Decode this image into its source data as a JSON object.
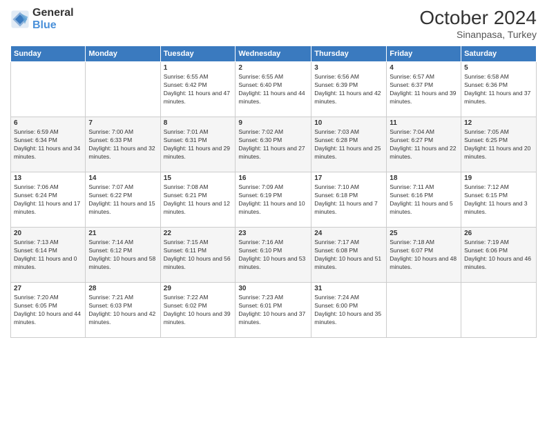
{
  "logo": {
    "line1": "General",
    "line2": "Blue"
  },
  "header": {
    "month": "October 2024",
    "location": "Sinanpasa, Turkey"
  },
  "weekdays": [
    "Sunday",
    "Monday",
    "Tuesday",
    "Wednesday",
    "Thursday",
    "Friday",
    "Saturday"
  ],
  "weeks": [
    [
      {
        "day": "",
        "sunrise": "",
        "sunset": "",
        "daylight": ""
      },
      {
        "day": "",
        "sunrise": "",
        "sunset": "",
        "daylight": ""
      },
      {
        "day": "1",
        "sunrise": "Sunrise: 6:55 AM",
        "sunset": "Sunset: 6:42 PM",
        "daylight": "Daylight: 11 hours and 47 minutes."
      },
      {
        "day": "2",
        "sunrise": "Sunrise: 6:55 AM",
        "sunset": "Sunset: 6:40 PM",
        "daylight": "Daylight: 11 hours and 44 minutes."
      },
      {
        "day": "3",
        "sunrise": "Sunrise: 6:56 AM",
        "sunset": "Sunset: 6:39 PM",
        "daylight": "Daylight: 11 hours and 42 minutes."
      },
      {
        "day": "4",
        "sunrise": "Sunrise: 6:57 AM",
        "sunset": "Sunset: 6:37 PM",
        "daylight": "Daylight: 11 hours and 39 minutes."
      },
      {
        "day": "5",
        "sunrise": "Sunrise: 6:58 AM",
        "sunset": "Sunset: 6:36 PM",
        "daylight": "Daylight: 11 hours and 37 minutes."
      }
    ],
    [
      {
        "day": "6",
        "sunrise": "Sunrise: 6:59 AM",
        "sunset": "Sunset: 6:34 PM",
        "daylight": "Daylight: 11 hours and 34 minutes."
      },
      {
        "day": "7",
        "sunrise": "Sunrise: 7:00 AM",
        "sunset": "Sunset: 6:33 PM",
        "daylight": "Daylight: 11 hours and 32 minutes."
      },
      {
        "day": "8",
        "sunrise": "Sunrise: 7:01 AM",
        "sunset": "Sunset: 6:31 PM",
        "daylight": "Daylight: 11 hours and 29 minutes."
      },
      {
        "day": "9",
        "sunrise": "Sunrise: 7:02 AM",
        "sunset": "Sunset: 6:30 PM",
        "daylight": "Daylight: 11 hours and 27 minutes."
      },
      {
        "day": "10",
        "sunrise": "Sunrise: 7:03 AM",
        "sunset": "Sunset: 6:28 PM",
        "daylight": "Daylight: 11 hours and 25 minutes."
      },
      {
        "day": "11",
        "sunrise": "Sunrise: 7:04 AM",
        "sunset": "Sunset: 6:27 PM",
        "daylight": "Daylight: 11 hours and 22 minutes."
      },
      {
        "day": "12",
        "sunrise": "Sunrise: 7:05 AM",
        "sunset": "Sunset: 6:25 PM",
        "daylight": "Daylight: 11 hours and 20 minutes."
      }
    ],
    [
      {
        "day": "13",
        "sunrise": "Sunrise: 7:06 AM",
        "sunset": "Sunset: 6:24 PM",
        "daylight": "Daylight: 11 hours and 17 minutes."
      },
      {
        "day": "14",
        "sunrise": "Sunrise: 7:07 AM",
        "sunset": "Sunset: 6:22 PM",
        "daylight": "Daylight: 11 hours and 15 minutes."
      },
      {
        "day": "15",
        "sunrise": "Sunrise: 7:08 AM",
        "sunset": "Sunset: 6:21 PM",
        "daylight": "Daylight: 11 hours and 12 minutes."
      },
      {
        "day": "16",
        "sunrise": "Sunrise: 7:09 AM",
        "sunset": "Sunset: 6:19 PM",
        "daylight": "Daylight: 11 hours and 10 minutes."
      },
      {
        "day": "17",
        "sunrise": "Sunrise: 7:10 AM",
        "sunset": "Sunset: 6:18 PM",
        "daylight": "Daylight: 11 hours and 7 minutes."
      },
      {
        "day": "18",
        "sunrise": "Sunrise: 7:11 AM",
        "sunset": "Sunset: 6:16 PM",
        "daylight": "Daylight: 11 hours and 5 minutes."
      },
      {
        "day": "19",
        "sunrise": "Sunrise: 7:12 AM",
        "sunset": "Sunset: 6:15 PM",
        "daylight": "Daylight: 11 hours and 3 minutes."
      }
    ],
    [
      {
        "day": "20",
        "sunrise": "Sunrise: 7:13 AM",
        "sunset": "Sunset: 6:14 PM",
        "daylight": "Daylight: 11 hours and 0 minutes."
      },
      {
        "day": "21",
        "sunrise": "Sunrise: 7:14 AM",
        "sunset": "Sunset: 6:12 PM",
        "daylight": "Daylight: 10 hours and 58 minutes."
      },
      {
        "day": "22",
        "sunrise": "Sunrise: 7:15 AM",
        "sunset": "Sunset: 6:11 PM",
        "daylight": "Daylight: 10 hours and 56 minutes."
      },
      {
        "day": "23",
        "sunrise": "Sunrise: 7:16 AM",
        "sunset": "Sunset: 6:10 PM",
        "daylight": "Daylight: 10 hours and 53 minutes."
      },
      {
        "day": "24",
        "sunrise": "Sunrise: 7:17 AM",
        "sunset": "Sunset: 6:08 PM",
        "daylight": "Daylight: 10 hours and 51 minutes."
      },
      {
        "day": "25",
        "sunrise": "Sunrise: 7:18 AM",
        "sunset": "Sunset: 6:07 PM",
        "daylight": "Daylight: 10 hours and 48 minutes."
      },
      {
        "day": "26",
        "sunrise": "Sunrise: 7:19 AM",
        "sunset": "Sunset: 6:06 PM",
        "daylight": "Daylight: 10 hours and 46 minutes."
      }
    ],
    [
      {
        "day": "27",
        "sunrise": "Sunrise: 7:20 AM",
        "sunset": "Sunset: 6:05 PM",
        "daylight": "Daylight: 10 hours and 44 minutes."
      },
      {
        "day": "28",
        "sunrise": "Sunrise: 7:21 AM",
        "sunset": "Sunset: 6:03 PM",
        "daylight": "Daylight: 10 hours and 42 minutes."
      },
      {
        "day": "29",
        "sunrise": "Sunrise: 7:22 AM",
        "sunset": "Sunset: 6:02 PM",
        "daylight": "Daylight: 10 hours and 39 minutes."
      },
      {
        "day": "30",
        "sunrise": "Sunrise: 7:23 AM",
        "sunset": "Sunset: 6:01 PM",
        "daylight": "Daylight: 10 hours and 37 minutes."
      },
      {
        "day": "31",
        "sunrise": "Sunrise: 7:24 AM",
        "sunset": "Sunset: 6:00 PM",
        "daylight": "Daylight: 10 hours and 35 minutes."
      },
      {
        "day": "",
        "sunrise": "",
        "sunset": "",
        "daylight": ""
      },
      {
        "day": "",
        "sunrise": "",
        "sunset": "",
        "daylight": ""
      }
    ]
  ]
}
